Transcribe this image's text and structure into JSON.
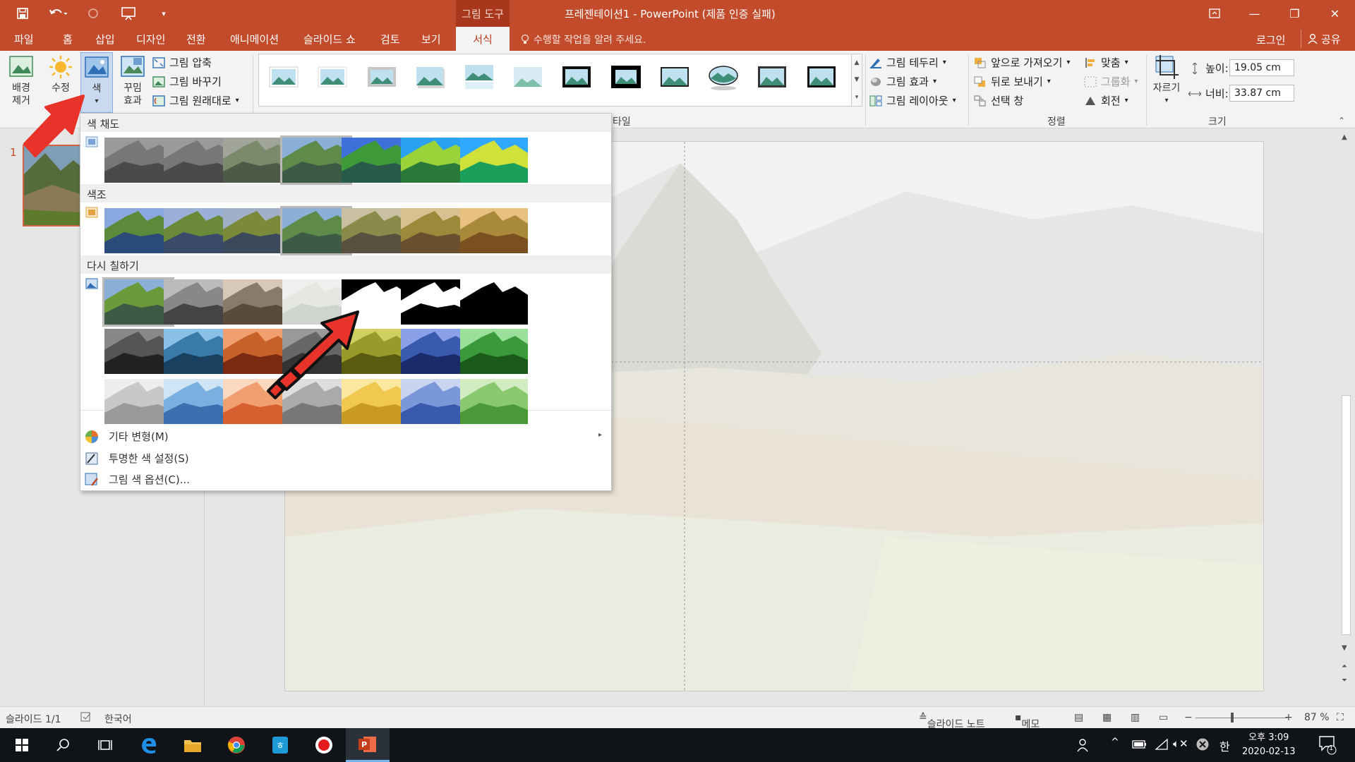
{
  "titlebar": {
    "context_tool": "그림 도구",
    "title": "프레젠테이션1 - PowerPoint (제품 인증 실패)"
  },
  "tabs": [
    "파일",
    "홈",
    "삽입",
    "디자인",
    "전환",
    "애니메이션",
    "슬라이드 쇼",
    "검토",
    "보기",
    "서식"
  ],
  "active_tab": "서식",
  "tell_me": "수행할 작업을 알려 주세요.",
  "login": "로그인",
  "share": "공유",
  "ribbon": {
    "remove_bg": "배경 제거",
    "corrections": "수정",
    "color": "색",
    "artistic": "꾸밈 효과",
    "compress": "그림 압축",
    "change": "그림 바꾸기",
    "reset": "그림 원래대로",
    "styles_label": "타일",
    "border": "그림 테두리",
    "effects": "그림 효과",
    "layout": "그림 레이아웃",
    "bring_forward": "앞으로 가져오기",
    "send_backward": "뒤로 보내기",
    "selection_pane": "선택 창",
    "align": "맞춤",
    "group": "그룹화",
    "rotate": "회전",
    "arrange_label": "정렬",
    "crop": "자르기",
    "height_label": "높이:",
    "height_value": "19.05 cm",
    "width_label": "너비:",
    "width_value": "33.87 cm",
    "size_label": "크기"
  },
  "dropdown": {
    "saturation": "색 채도",
    "tone": "색조",
    "recolor": "다시 칠하기",
    "more_variations": "기타 변형(M)",
    "set_transparent": "투명한 색 설정(S)",
    "color_options": "그림 색 옵션(C)..."
  },
  "slide_panel": {
    "number": "1"
  },
  "statusbar": {
    "slide": "슬라이드 1/1",
    "language": "한국어",
    "notes": "슬라이드 노트",
    "comments": "메모",
    "zoom": "87 %"
  },
  "taskbar": {
    "time": "오후 3:09",
    "date": "2020-02-13",
    "ime": "한",
    "notif_count": "1"
  },
  "colors": {
    "accent": "#c14b2b",
    "arrow": "#e8332b"
  }
}
